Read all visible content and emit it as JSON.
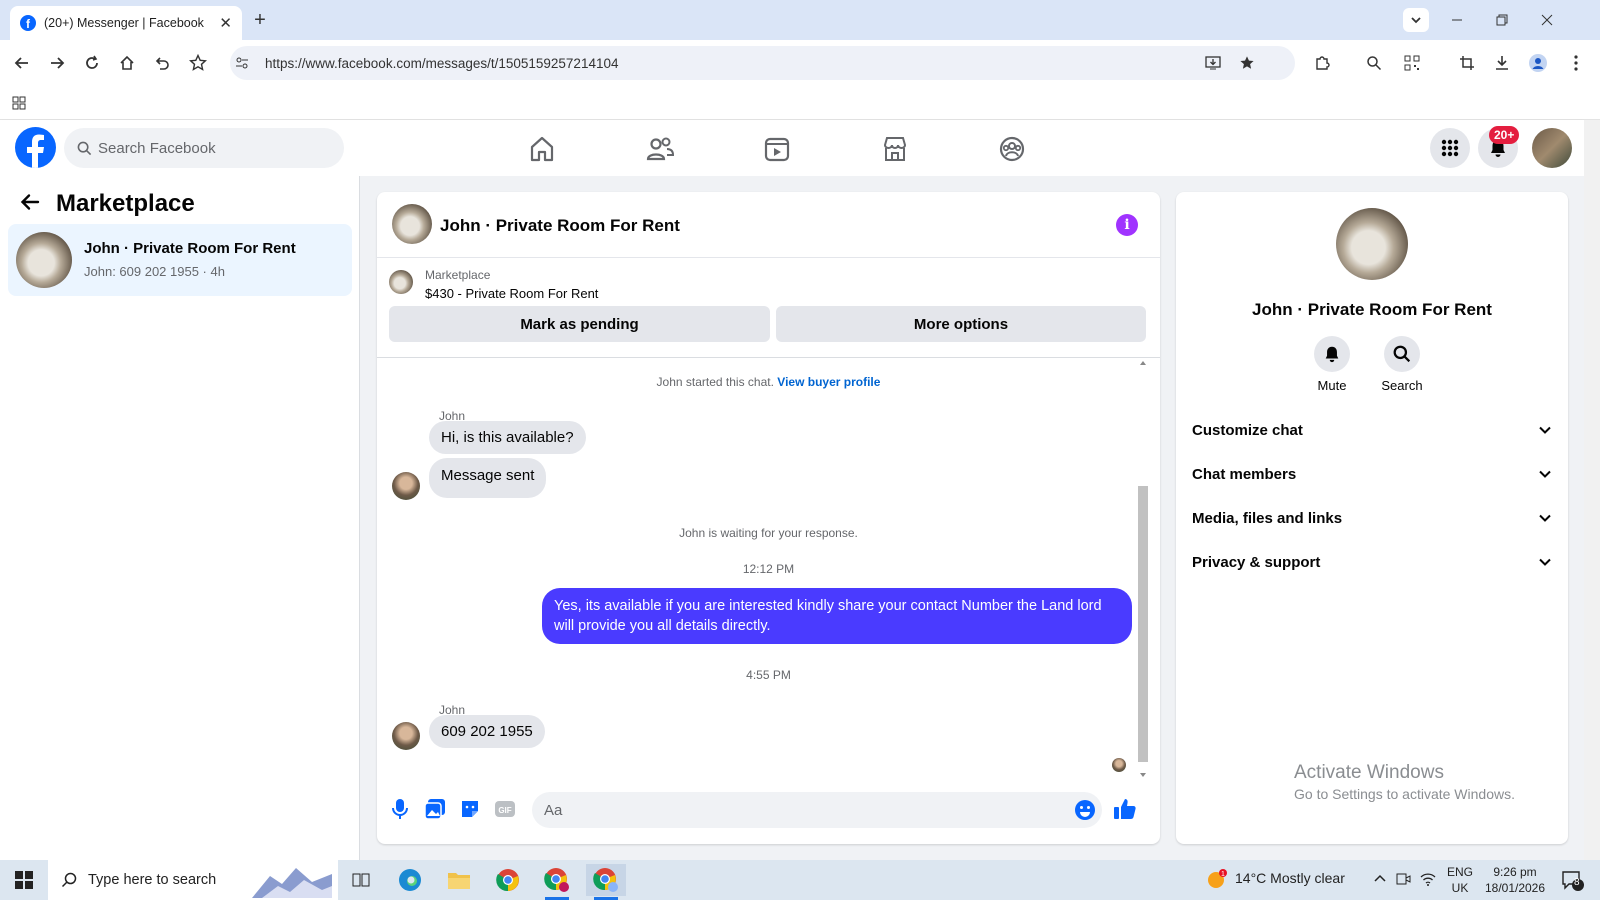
{
  "browser": {
    "tab_title": "(20+) Messenger | Facebook",
    "tab_close": "✕",
    "new_tab": "+",
    "url": "https://www.facebook.com/messages/t/1505159257214104"
  },
  "facebook": {
    "search_placeholder": "Search Facebook",
    "notification_badge": "20+",
    "brand_color": "#0866ff"
  },
  "left": {
    "title": "Marketplace",
    "conversation": {
      "name": "John · Private Room For Rent",
      "preview": "John: 609 202 1955 · 4h"
    }
  },
  "chat": {
    "header_name": "John · Private Room For Rent",
    "info_icon": "i",
    "listing_source": "Marketplace",
    "listing_title": "$430 - Private Room For Rent",
    "mark_pending": "Mark as pending",
    "more_options": "More options",
    "started_note": "John started this chat.",
    "view_buyer": "View buyer profile",
    "sender1": "John",
    "msg1": "Hi, is this available?",
    "msg2": "Message sent",
    "waiting_note": "John is waiting for your response.",
    "time1": "12:12 PM",
    "outgoing": "Yes, its available if you are interested kindly share your contact Number the Land lord will provide you all details directly.",
    "time2": "4:55 PM",
    "sender2": "John",
    "msg3": "609 202 1955",
    "composer_placeholder": "Aa",
    "accent": "#4a3bff"
  },
  "right": {
    "name": "John · Private Room For Rent",
    "mute": "Mute",
    "search": "Search",
    "rows": [
      "Customize chat",
      "Chat members",
      "Media, files and links",
      "Privacy & support"
    ],
    "activate_title": "Activate Windows",
    "activate_sub": "Go to Settings to activate Windows."
  },
  "taskbar": {
    "search_placeholder": "Type here to search",
    "weather": "14°C  Mostly clear",
    "lang1": "ENG",
    "lang2": "UK",
    "time": "9:26 pm",
    "date": "18/01/2026",
    "notif_count": "8"
  }
}
